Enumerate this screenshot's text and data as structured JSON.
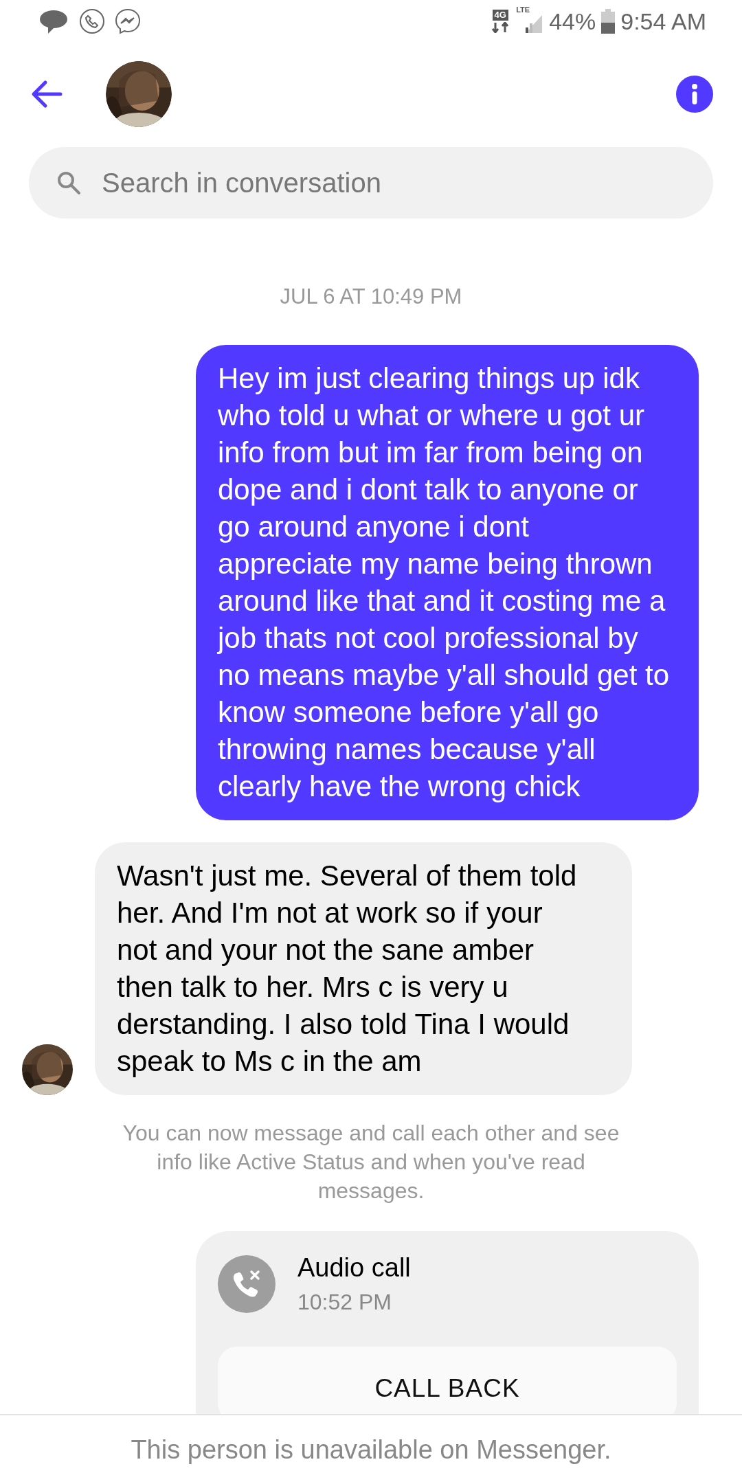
{
  "status_bar": {
    "battery": "44%",
    "time": "9:54 AM",
    "network": "4G",
    "signal_label": "LTE"
  },
  "header": {
    "search": {
      "placeholder": "Search in conversation"
    }
  },
  "messages": [
    {
      "kind": "timestamp",
      "text": "JUL 6 AT 10:49 PM"
    },
    {
      "kind": "outgoing",
      "text": "Hey im just clearing things up idk who told u what or where u got ur info from but im far from being on dope and i dont talk to anyone or go around anyone i dont appreciate my name being thrown around like that and it costing me a job thats not cool professional by no means maybe y'all should get to know someone before y'all go throwing names because y'all clearly have the wrong chick"
    },
    {
      "kind": "incoming",
      "text": "Wasn't just me. Several of them told her. And I'm not at work so if your not and your not the sane amber then talk to her. Mrs c is very u derstanding. I also told Tina I would speak to Ms c in the am"
    },
    {
      "kind": "notice",
      "text": "You can now message and call each other and see info like Active Status and when you've read messages."
    },
    {
      "kind": "call",
      "title": "Audio call",
      "time": "10:52 PM",
      "button": "CALL BACK"
    }
  ],
  "footer": {
    "text": "This person is unavailable on Messenger."
  }
}
